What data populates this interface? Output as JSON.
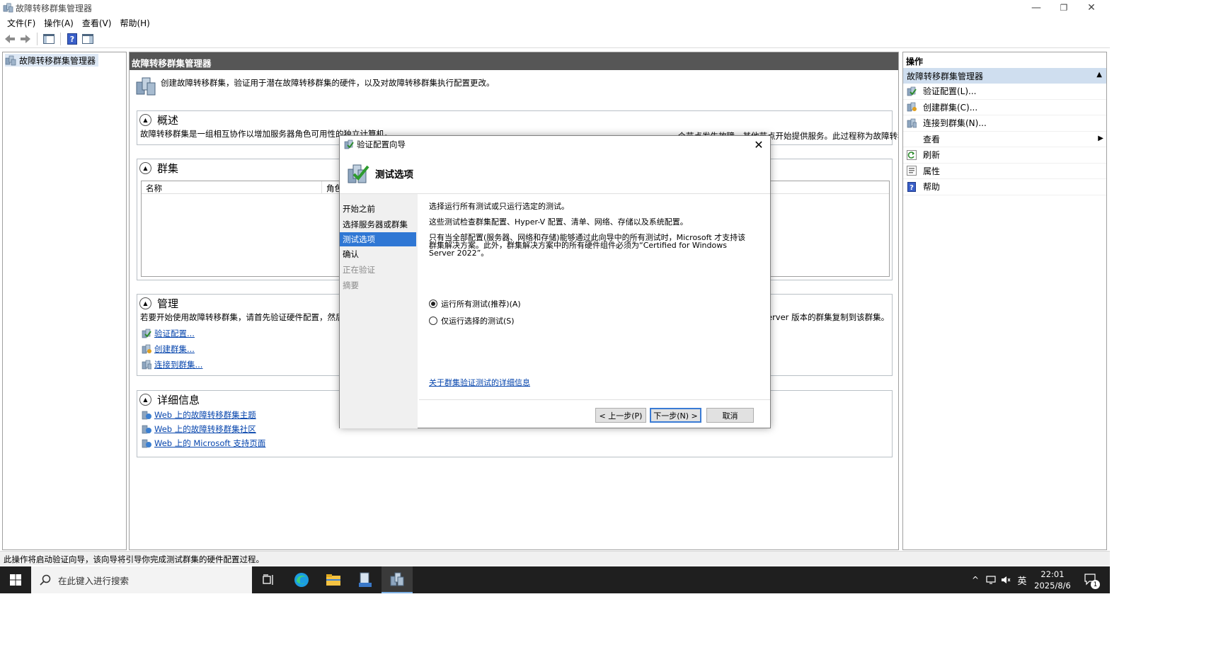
{
  "window": {
    "title": "故障转移群集管理器",
    "controls": {
      "minimize": "—",
      "restore": "❐",
      "close": "✕"
    }
  },
  "menu": [
    "文件(F)",
    "操作(A)",
    "查看(V)",
    "帮助(H)"
  ],
  "tree": {
    "root": "故障转移群集管理器"
  },
  "center": {
    "header": "故障转移群集管理器",
    "intro": "创建故障转移群集，验证用于潜在故障转移群集的硬件，以及对故障转移群集执行配置更改。",
    "overview": {
      "title": "概述",
      "text_left": "故障转移群集是一组相互协作以增加服务器角色可用性的独立计算机。",
      "text_right": "一个节点发生故障，其他节点开始提供服务。此过程称为故障转移。"
    },
    "clusters": {
      "title": "群集",
      "columns": [
        "名称",
        "角色"
      ]
    },
    "management": {
      "title": "管理",
      "text_left": "若要开始使用故障转移群集，请首先验证硬件配置，然后创",
      "text_right": "erver 版本的群集复制到该群集。",
      "links": [
        "验证配置...",
        "创建群集...",
        "连接到群集..."
      ]
    },
    "details": {
      "title": "详细信息",
      "links": [
        "Web 上的故障转移群集主题",
        "Web 上的故障转移群集社区",
        "Web 上的 Microsoft 支持页面"
      ]
    }
  },
  "actions": {
    "header": "操作",
    "subheader": "故障转移群集管理器",
    "items": [
      {
        "label": "验证配置(L)...",
        "icon": "validate-icon"
      },
      {
        "label": "创建群集(C)...",
        "icon": "create-cluster-icon"
      },
      {
        "label": "连接到群集(N)...",
        "icon": "connect-cluster-icon"
      },
      {
        "label": "查看",
        "icon": "none",
        "submenu": true
      },
      {
        "label": "刷新",
        "icon": "refresh-icon"
      },
      {
        "label": "属性",
        "icon": "properties-icon"
      },
      {
        "label": "帮助",
        "icon": "help-icon"
      }
    ]
  },
  "status": "此操作将启动验证向导，该向导将引导你完成测试群集的硬件配置过程。",
  "taskbar": {
    "search_placeholder": "在此键入进行搜索",
    "ime": "英",
    "time": "22:01",
    "date": "2025/8/6",
    "notification_count": "1"
  },
  "dialog": {
    "title": "验证配置向导",
    "heading": "测试选项",
    "nav": [
      {
        "label": "开始之前",
        "state": "normal"
      },
      {
        "label": "选择服务器或群集",
        "state": "normal"
      },
      {
        "label": "测试选项",
        "state": "current"
      },
      {
        "label": "确认",
        "state": "normal"
      },
      {
        "label": "正在验证",
        "state": "disabled"
      },
      {
        "label": "摘要",
        "state": "disabled"
      }
    ],
    "line1": "选择运行所有测试或只运行选定的测试。",
    "line2": "这些测试检查群集配置、Hyper-V 配置、清单、网络、存储以及系统配置。",
    "line3": "只有当全部配置(服务器、网络和存储)能够通过此向导中的所有测试时，Microsoft 才支持该\n群集解决方案。此外，群集解决方案中的所有硬件组件必须为“Certified for Windows\nServer 2022”。",
    "options": [
      {
        "label": "运行所有测试(推荐)(A)",
        "selected": true
      },
      {
        "label": "仅运行选择的测试(S)",
        "selected": false
      }
    ],
    "more_info_link": "关于群集验证测试的详细信息",
    "buttons": {
      "back": "< 上一步(P)",
      "next": "下一步(N) >",
      "cancel": "取消"
    },
    "colors": {
      "accent": "#2f77d4",
      "link": "#0645ad"
    }
  }
}
